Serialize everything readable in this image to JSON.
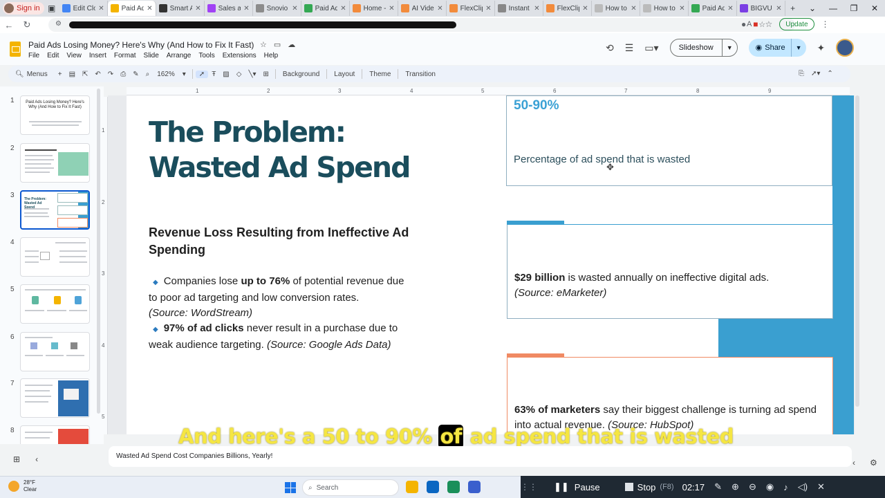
{
  "browser": {
    "signin_label": "Sign in",
    "tabs": [
      {
        "label": "Edit Clo",
        "color": "#4285f4"
      },
      {
        "label": "Paid Ad",
        "color": "#f4b400",
        "active": true
      },
      {
        "label": "Smart A",
        "color": "#333333"
      },
      {
        "label": "Sales a",
        "color": "#a142f4"
      },
      {
        "label": "Snovio",
        "color": "#8c8c8c"
      },
      {
        "label": "Paid Ad",
        "color": "#34a853"
      },
      {
        "label": "Home -",
        "color": "#f28b3c"
      },
      {
        "label": "AI Video",
        "color": "#f28b3c"
      },
      {
        "label": "FlexClip",
        "color": "#f28b3c"
      },
      {
        "label": "Instant",
        "color": "#888888"
      },
      {
        "label": "FlexClip",
        "color": "#f28b3c"
      },
      {
        "label": "How to",
        "color": "#bbbbbb"
      },
      {
        "label": "How to",
        "color": "#bbbbbb"
      },
      {
        "label": "Paid Ad",
        "color": "#34a853"
      },
      {
        "label": "BIGVU",
        "color": "#7b3fe4"
      }
    ],
    "update_label": "Update"
  },
  "doc": {
    "title": "Paid Ads Losing Money? Here's Why (And How to Fix It Fast)",
    "menu": [
      "File",
      "Edit",
      "View",
      "Insert",
      "Format",
      "Slide",
      "Arrange",
      "Tools",
      "Extensions",
      "Help"
    ],
    "slideshow_label": "Slideshow",
    "share_label": "Share"
  },
  "toolbar": {
    "menus_label": "Menus",
    "zoom": "162%",
    "background_label": "Background",
    "layout_label": "Layout",
    "theme_label": "Theme",
    "transition_label": "Transition"
  },
  "filmstrip": {
    "slides": [
      {
        "num": "1",
        "title": "Paid Ads Losing Money? Here's Why (And How to Fix It Fast)"
      },
      {
        "num": "2",
        "title": ""
      },
      {
        "num": "3",
        "title": "The Problem: Wasted Ad Spend",
        "current": true
      },
      {
        "num": "4",
        "title": ""
      },
      {
        "num": "5",
        "title": ""
      },
      {
        "num": "6",
        "title": ""
      },
      {
        "num": "7",
        "title": ""
      },
      {
        "num": "8",
        "title": ""
      }
    ]
  },
  "ruler": {
    "h": [
      "1",
      "2",
      "3",
      "4",
      "5",
      "6",
      "7",
      "8",
      "9"
    ],
    "v": [
      "1",
      "2",
      "3",
      "4",
      "5"
    ]
  },
  "slide": {
    "title": "The Problem: Wasted Ad Spend",
    "subtitle": "Revenue Loss Resulting from Ineffective Ad Spending",
    "bullet1_pre": "Companies lose ",
    "bullet1_bold": "up to 76%",
    "bullet1_post": " of potential revenue due to poor ad targeting and low conversion rates.",
    "bullet1_src": "(Source: WordStream)",
    "bullet2_bold": "97% of ad clicks",
    "bullet2_post": " never result in a purchase due to weak audience targeting. ",
    "bullet2_src": "(Source: Google Ads Data)",
    "card1_stat": "50-90%",
    "card1_desc": "Percentage of ad spend that is wasted",
    "card2_bold": "$29 billion",
    "card2_text": " is wasted annually on ineffective digital ads.",
    "card2_src": "(Source: eMarketer)",
    "card3_bold": "63% of marketers",
    "card3_text": " say their biggest challenge is turning ad spend into actual revenue. ",
    "card3_src": "(Source: HubSpot)",
    "colors": {
      "accent_blue": "#3a9fd0",
      "accent_orange": "#f08a63",
      "title": "#1a4d5c"
    }
  },
  "caption": {
    "pre": "And here's a 50 to 90% ",
    "highlight": "of",
    "post": " ad spend that is wasted"
  },
  "notes": {
    "text": "Wasted Ad Spend Cost Companies Billions, Yearly!"
  },
  "taskbar": {
    "temp": "28°F",
    "condition": "Clear",
    "search_label": "Search"
  },
  "recorder": {
    "pause_label": "Pause",
    "stop_label": "Stop",
    "stop_key": "(F8)",
    "timer": "02:17"
  }
}
